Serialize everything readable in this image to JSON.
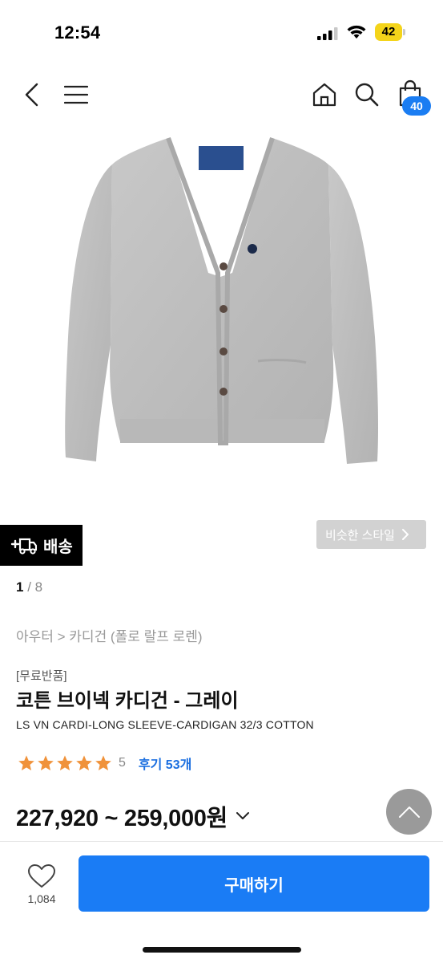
{
  "status_bar": {
    "time": "12:54",
    "battery": "42",
    "battery_color": "#f4d41a"
  },
  "nav": {
    "back_icon": "chevron-left-icon",
    "menu_icon": "hamburger-icon",
    "home_icon": "home-icon",
    "search_icon": "search-icon",
    "cart_icon": "shopping-bag-icon",
    "cart_count": "40",
    "badge_color": "#1b7df2"
  },
  "product": {
    "image_desc_icon": "cardigan-image",
    "delivery_label": "배송",
    "similar_label": "비슷한 스타일",
    "page_current": "1",
    "page_sep": " / ",
    "page_total": "8",
    "breadcrumb": "아우터 > 카디건 (폴로 랄프 로렌)",
    "tag": "[무료반품]",
    "title": "코튼 브이넥 카디건 - 그레이",
    "subtitle": "LS VN CARDI-LONG SLEEVE-CARDIGAN 32/3 COTTON",
    "rating": 5,
    "rating_text": "5",
    "reviews": "후기 53개",
    "price": "227,920 ~ 259,000원",
    "star_color": "#f0923a"
  },
  "footer": {
    "wish_count": "1,084",
    "buy_label": "구매하기",
    "buy_color": "#1a7cf5"
  }
}
